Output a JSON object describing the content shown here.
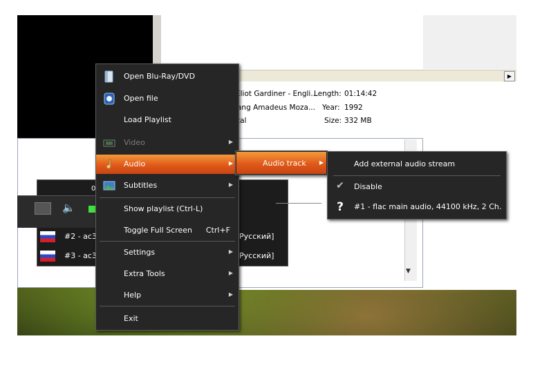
{
  "info": {
    "artist": "Eliot Gardiner - Engli...",
    "composer": "ang Amadeus Moza...",
    "genre": "tal",
    "length_label": "Length:",
    "length": "01:14:42",
    "year_label": "Year:",
    "year": "1992",
    "size_label": "Size:",
    "size": "332 MB"
  },
  "player": {
    "time": "0"
  },
  "audio_list": {
    "rows": [
      {
        "left": "#2 - ac3",
        "right": "Русский]"
      },
      {
        "left": "#3 - ac3",
        "right": "Русский]"
      }
    ]
  },
  "main_menu": {
    "items": [
      {
        "label": "Open Blu-Ray/DVD",
        "icon": "disc-folder-icon"
      },
      {
        "label": "Open file",
        "icon": "open-file-icon"
      },
      {
        "label": "Load Playlist"
      },
      {
        "label": "Video",
        "icon": "film-icon",
        "disabled": true,
        "submenu": true
      },
      {
        "label": "Audio",
        "icon": "music-note-icon",
        "submenu": true,
        "highlighted": true
      },
      {
        "label": "Subtitles",
        "icon": "picture-icon",
        "submenu": true
      },
      {
        "label": "Show playlist (Ctrl-L)"
      },
      {
        "label": "Toggle Full Screen",
        "shortcut": "Ctrl+F"
      },
      {
        "label": "Settings",
        "submenu": true
      },
      {
        "label": "Extra Tools",
        "submenu": true
      },
      {
        "label": "Help",
        "submenu": true
      },
      {
        "label": "Exit"
      }
    ]
  },
  "audio_submenu": {
    "items": [
      {
        "label": "Audio track",
        "submenu": true
      }
    ]
  },
  "audio_track_submenu": {
    "items": [
      {
        "label": "Add external audio stream"
      },
      {
        "label": "Disable",
        "checked": true
      },
      {
        "label": "#1 - flac main audio, 44100 kHz, 2 Ch.",
        "marker": "?"
      }
    ]
  },
  "colors": {
    "menu_bg": "#262626",
    "highlight": "#e0591a"
  }
}
